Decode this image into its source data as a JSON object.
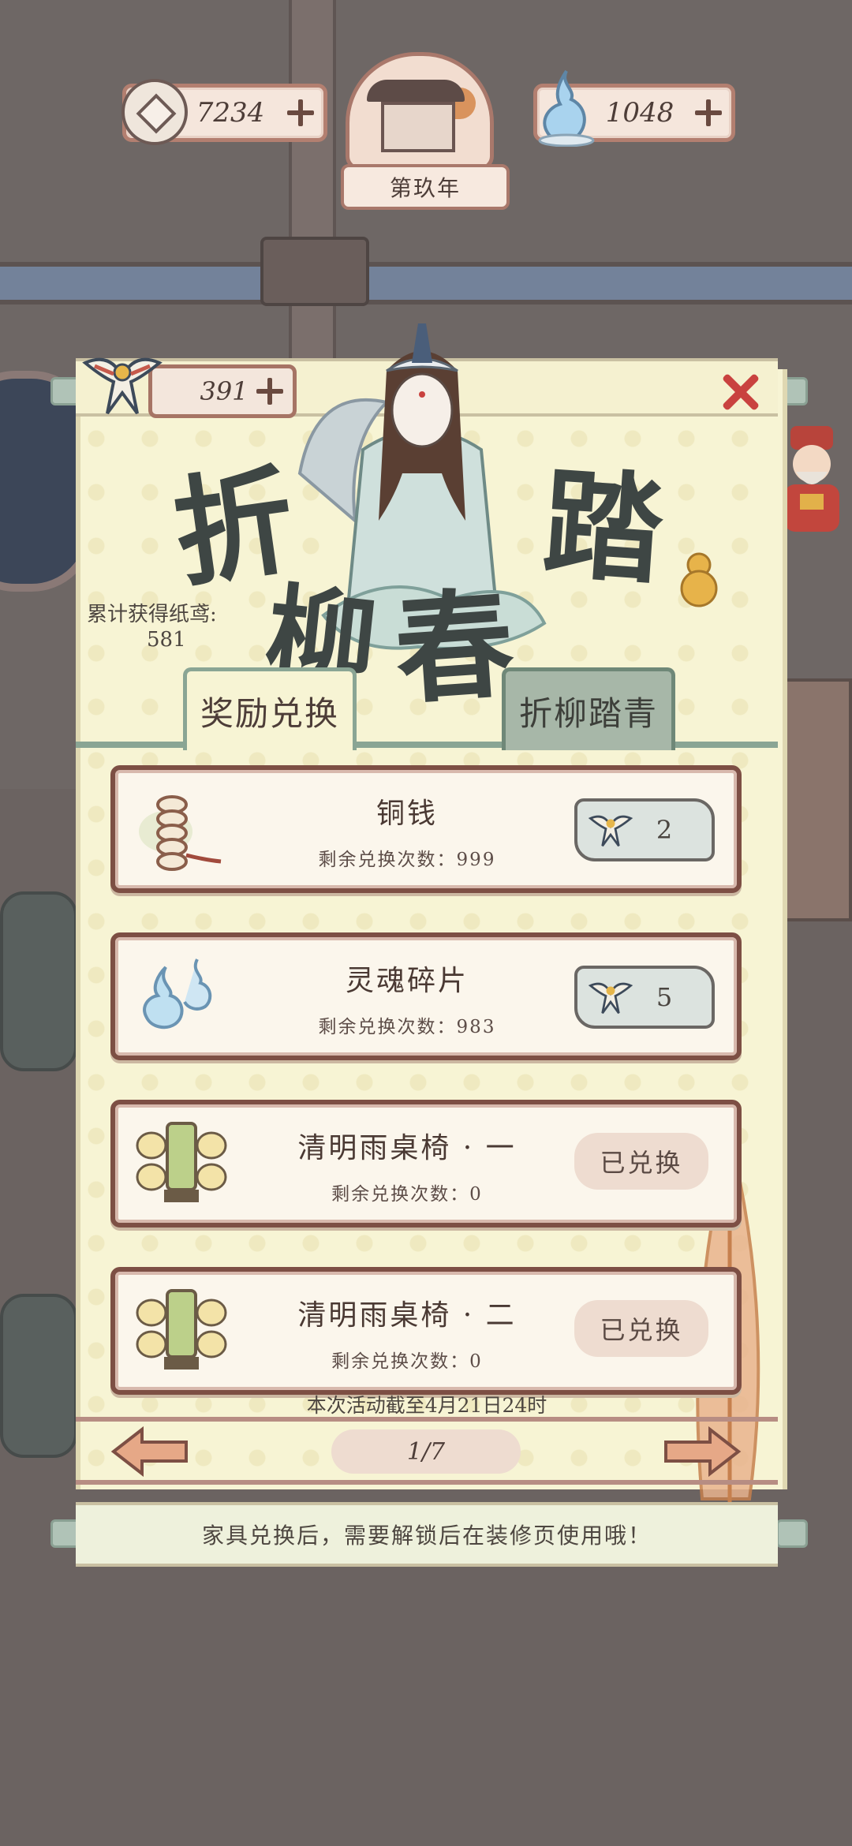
{
  "hud": {
    "coins": "7234",
    "souls": "1048",
    "year": "第玖年"
  },
  "event": {
    "kites": "391",
    "title_chars": [
      "折",
      "柳",
      "春",
      "踏"
    ],
    "total_label": "累计获得纸鸢:",
    "total_value": "581"
  },
  "tabs": [
    {
      "label": "奖励兑换",
      "active": true
    },
    {
      "label": "折柳踏青",
      "active": false
    }
  ],
  "rewards": [
    {
      "name": "铜钱",
      "remaining": "剩余兑换次数：999",
      "price": "2",
      "redeemed": false,
      "icon": "coin-string-icon"
    },
    {
      "name": "灵魂碎片",
      "remaining": "剩余兑换次数：983",
      "price": "5",
      "redeemed": false,
      "icon": "soul-fragment-icon"
    },
    {
      "name": "清明雨桌椅 · 一",
      "remaining": "剩余兑换次数：0",
      "status": "已兑换",
      "redeemed": true,
      "icon": "table-chairs-icon"
    },
    {
      "name": "清明雨桌椅 · 二",
      "remaining": "剩余兑换次数：0",
      "status": "已兑换",
      "redeemed": true,
      "icon": "table-chairs-icon"
    }
  ],
  "deadline": "本次活动截至4月21日24时",
  "pagination": {
    "current": "1/7"
  },
  "hint": "家具兑换后，需要解锁后在装修页使用哦！",
  "colors": {
    "panel": "#f7f4d4",
    "card_border": "#7d4f44",
    "close": "#c9423f",
    "tab_active_border": "#8aa594"
  }
}
